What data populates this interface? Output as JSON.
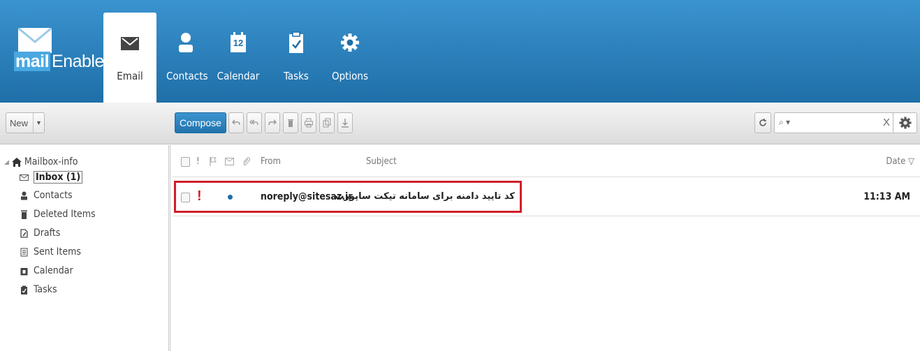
{
  "brand": {
    "mail": "mail",
    "enable": "Enable"
  },
  "nav": {
    "email": "Email",
    "contacts": "Contacts",
    "calendar": "Calendar",
    "calendar_day": "12",
    "tasks": "Tasks",
    "options": "Options"
  },
  "toolbar": {
    "new_label": "New",
    "compose_label": "Compose",
    "search": {
      "value": "",
      "clear": "X"
    }
  },
  "sidebar": {
    "root": "Mailbox-info",
    "items": [
      {
        "label": "Inbox (1)",
        "icon": "envelope-icon"
      },
      {
        "label": "Contacts",
        "icon": "person-icon"
      },
      {
        "label": "Deleted Items",
        "icon": "trash-icon"
      },
      {
        "label": "Drafts",
        "icon": "draft-icon"
      },
      {
        "label": "Sent Items",
        "icon": "sent-icon"
      },
      {
        "label": "Calendar",
        "icon": "calendar-icon"
      },
      {
        "label": "Tasks",
        "icon": "tasks-icon"
      }
    ]
  },
  "list": {
    "columns": {
      "importance": "!",
      "from": "From",
      "subject": "Subject",
      "date": "Date ▽"
    },
    "messages": [
      {
        "importance": "!",
        "from": "noreply@sitesaz.ir",
        "subject": "کد تایید دامنه برای سامانه تیکت ساپورت",
        "date": "11:13 AM"
      }
    ]
  },
  "colors": {
    "banner": "#2a7fb8",
    "compose": "#2676b0",
    "highlight": "#d0202a",
    "unread_dot": "#1f6fa8",
    "importance": "#d0202a"
  }
}
